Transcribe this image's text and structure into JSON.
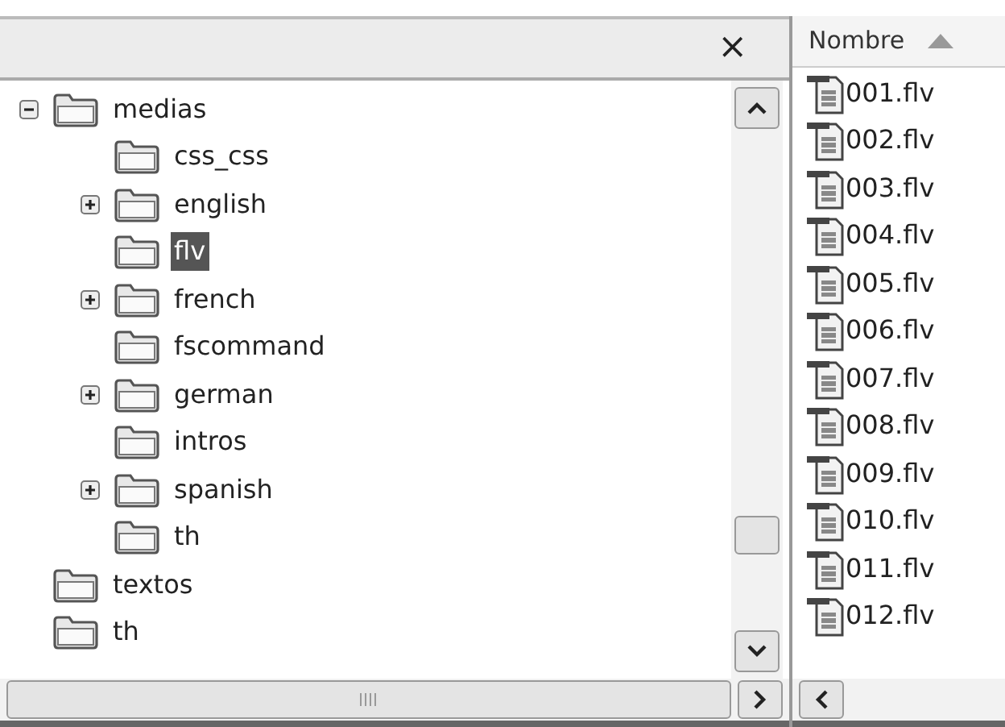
{
  "folder_pane": {
    "close_label": "×",
    "tree": [
      {
        "label": "medias",
        "expanded": true,
        "selected": false,
        "children": [
          {
            "label": "css_css",
            "selected": false
          },
          {
            "label": "english",
            "expanded": false,
            "selected": false
          },
          {
            "label": "flv",
            "selected": true
          },
          {
            "label": "french",
            "expanded": false,
            "selected": false
          },
          {
            "label": "fscommand",
            "selected": false
          },
          {
            "label": "german",
            "expanded": false,
            "selected": false
          },
          {
            "label": "intros",
            "selected": false
          },
          {
            "label": "spanish",
            "expanded": false,
            "selected": false
          },
          {
            "label": "th",
            "selected": false
          }
        ]
      },
      {
        "label": "textos",
        "selected": false
      },
      {
        "label": "th",
        "selected": false
      }
    ]
  },
  "file_list": {
    "column": "Nombre",
    "files": [
      "001.flv",
      "002.flv",
      "003.flv",
      "004.flv",
      "005.flv",
      "006.flv",
      "007.flv",
      "008.flv",
      "009.flv",
      "010.flv",
      "011.flv",
      "012.flv"
    ]
  }
}
